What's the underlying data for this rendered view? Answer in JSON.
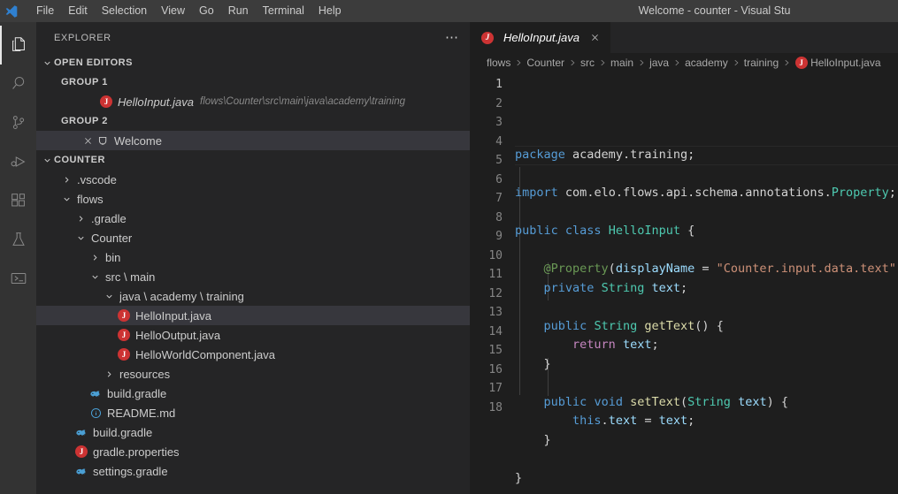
{
  "titlebar": {
    "window_title": "Welcome - counter - Visual Stu",
    "logo_icon": "vscode-logo",
    "menus": [
      "File",
      "Edit",
      "Selection",
      "View",
      "Go",
      "Run",
      "Terminal",
      "Help"
    ]
  },
  "activitybar": {
    "items": [
      {
        "name": "explorer",
        "icon": "files-icon",
        "active": true
      },
      {
        "name": "search",
        "icon": "search-icon",
        "active": false
      },
      {
        "name": "source-control",
        "icon": "source-control-icon",
        "active": false
      },
      {
        "name": "run-and-debug",
        "icon": "run-debug-icon",
        "active": false
      },
      {
        "name": "extensions",
        "icon": "extensions-icon",
        "active": false
      },
      {
        "name": "testing",
        "icon": "flask-icon",
        "active": false
      },
      {
        "name": "terminal-panel",
        "icon": "powershell-icon",
        "active": false
      }
    ]
  },
  "sidebar": {
    "title": "EXPLORER",
    "more_actions": "⋯",
    "open_editors": {
      "header": "OPEN EDITORS",
      "expanded": true,
      "groups": [
        {
          "label": "GROUP 1",
          "items": [
            {
              "name": "HelloInput.java",
              "description": "flows\\Counter\\src\\main\\java\\academy\\training",
              "icon": "java-file-icon",
              "italic": true,
              "selected": false,
              "has_close": false
            }
          ]
        },
        {
          "label": "GROUP 2",
          "items": [
            {
              "name": "Welcome",
              "description": "",
              "icon": "welcome-icon",
              "italic": false,
              "selected": true,
              "has_close": true
            }
          ]
        }
      ]
    },
    "workspace": {
      "header": "COUNTER",
      "expanded": true,
      "tree": [
        {
          "label": ".vscode",
          "depth": 1,
          "type": "folder",
          "expanded": false,
          "icon": ""
        },
        {
          "label": "flows",
          "depth": 1,
          "type": "folder",
          "expanded": true,
          "icon": ""
        },
        {
          "label": ".gradle",
          "depth": 2,
          "type": "folder",
          "expanded": false,
          "icon": ""
        },
        {
          "label": "Counter",
          "depth": 2,
          "type": "folder",
          "expanded": true,
          "icon": ""
        },
        {
          "label": "bin",
          "depth": 3,
          "type": "folder",
          "expanded": false,
          "icon": ""
        },
        {
          "label": "src \\ main",
          "depth": 3,
          "type": "folder",
          "expanded": true,
          "icon": ""
        },
        {
          "label": "java \\ academy \\ training",
          "depth": 4,
          "type": "folder",
          "expanded": true,
          "icon": ""
        },
        {
          "label": "HelloInput.java",
          "depth": 5,
          "type": "file",
          "selected": true,
          "icon": "java-file-icon"
        },
        {
          "label": "HelloOutput.java",
          "depth": 5,
          "type": "file",
          "selected": false,
          "icon": "java-file-icon"
        },
        {
          "label": "HelloWorldComponent.java",
          "depth": 5,
          "type": "file",
          "selected": false,
          "icon": "java-file-icon"
        },
        {
          "label": "resources",
          "depth": 4,
          "type": "folder",
          "expanded": false,
          "icon": ""
        },
        {
          "label": "build.gradle",
          "depth": 3,
          "type": "file",
          "selected": false,
          "icon": "gradle-file-icon"
        },
        {
          "label": "README.md",
          "depth": 3,
          "type": "file",
          "selected": false,
          "icon": "markdown-file-icon"
        },
        {
          "label": "build.gradle",
          "depth": 2,
          "type": "file",
          "selected": false,
          "icon": "gradle-file-icon"
        },
        {
          "label": "gradle.properties",
          "depth": 2,
          "type": "file",
          "selected": false,
          "icon": "java-file-icon"
        },
        {
          "label": "settings.gradle",
          "depth": 2,
          "type": "file",
          "selected": false,
          "icon": "gradle-file-icon"
        }
      ]
    }
  },
  "editor": {
    "tabs": [
      {
        "label": "HelloInput.java",
        "icon": "java-file-icon",
        "active": true,
        "preview": true,
        "close_icon": "close-icon"
      }
    ],
    "breadcrumb": [
      {
        "label": "flows",
        "icon": ""
      },
      {
        "label": "Counter",
        "icon": ""
      },
      {
        "label": "src",
        "icon": ""
      },
      {
        "label": "main",
        "icon": ""
      },
      {
        "label": "java",
        "icon": ""
      },
      {
        "label": "academy",
        "icon": ""
      },
      {
        "label": "training",
        "icon": ""
      },
      {
        "label": "HelloInput.java",
        "icon": "java-file-icon"
      }
    ],
    "line_numbers": [
      "1",
      "2",
      "3",
      "4",
      "5",
      "6",
      "7",
      "8",
      "9",
      "10",
      "11",
      "12",
      "13",
      "14",
      "15",
      "16",
      "17",
      "18"
    ],
    "active_line": 1,
    "code_lines": [
      "package academy.training;",
      "",
      "import com.elo.flows.api.schema.annotations.Property;",
      "",
      "public class HelloInput {",
      "",
      "    @Property(displayName = \"Counter.input.data.text\")",
      "    private String text;",
      "",
      "    public String getText() {",
      "        return text;",
      "    }",
      "",
      "    public void setText(String text) {",
      "        this.text = text;",
      "    }",
      "",
      "}"
    ]
  },
  "colors": {
    "titlebar_bg": "#3c3c3c",
    "activitybar_bg": "#333333",
    "sidebar_bg": "#252526",
    "editor_bg": "#1e1e1e",
    "selection_bg": "#37373d",
    "java_icon": "#cc3333",
    "gradle_icon": "#4a9fd4",
    "keyword": "#569cd6",
    "type": "#4ec9b0",
    "string": "#ce9178",
    "control": "#c586c0",
    "variable": "#9cdcfe",
    "text": "#d4d4d4"
  }
}
